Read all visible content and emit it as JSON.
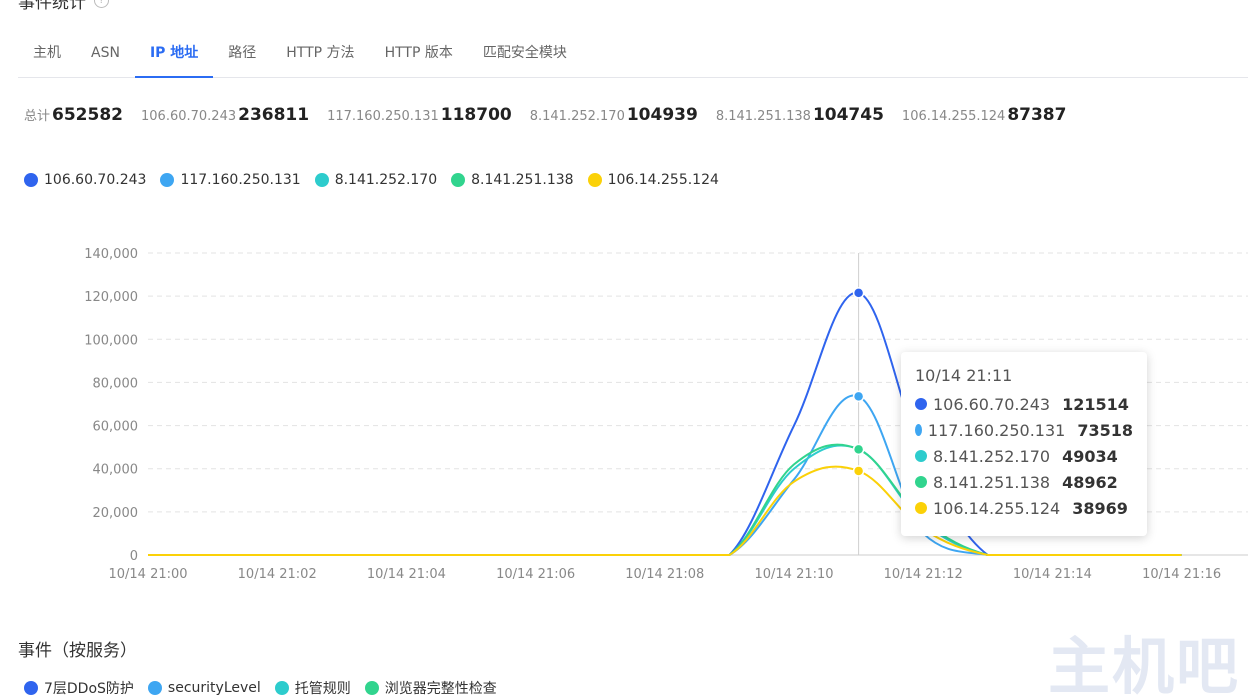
{
  "section": {
    "title": "事件统计",
    "help_icon": "question-circle-icon"
  },
  "tabs": [
    {
      "label": "主机",
      "active": false
    },
    {
      "label": "ASN",
      "active": false
    },
    {
      "label": "IP 地址",
      "active": true
    },
    {
      "label": "路径",
      "active": false
    },
    {
      "label": "HTTP 方法",
      "active": false
    },
    {
      "label": "HTTP 版本",
      "active": false
    },
    {
      "label": "匹配安全模块",
      "active": false
    }
  ],
  "stats": [
    {
      "label": "总计",
      "value": "652582"
    },
    {
      "label": "106.60.70.243",
      "value": "236811"
    },
    {
      "label": "117.160.250.131",
      "value": "118700"
    },
    {
      "label": "8.141.252.170",
      "value": "104939"
    },
    {
      "label": "8.141.251.138",
      "value": "104745"
    },
    {
      "label": "106.14.255.124",
      "value": "87387"
    }
  ],
  "colors": {
    "accent": "#2b6cf3",
    "series": [
      "#2f64ee",
      "#3ea6f2",
      "#2dcccd",
      "#31d48e",
      "#fbd108"
    ]
  },
  "chart_data": {
    "type": "line",
    "x": [
      "10/14 21:00",
      "10/14 21:01",
      "10/14 21:02",
      "10/14 21:03",
      "10/14 21:04",
      "10/14 21:05",
      "10/14 21:06",
      "10/14 21:07",
      "10/14 21:08",
      "10/14 21:09",
      "10/14 21:10",
      "10/14 21:11",
      "10/14 21:12",
      "10/14 21:13",
      "10/14 21:14",
      "10/14 21:15",
      "10/14 21:16"
    ],
    "xticks": [
      "10/14 21:00",
      "10/14 21:02",
      "10/14 21:04",
      "10/14 21:06",
      "10/14 21:08",
      "10/14 21:10",
      "10/14 21:12",
      "10/14 21:14",
      "10/14 21:16"
    ],
    "yticks": [
      "0",
      "20,000",
      "40,000",
      "60,000",
      "80,000",
      "100,000",
      "120,000",
      "140,000"
    ],
    "ylim": [
      0,
      140000
    ],
    "grid": true,
    "legend_position": "top-left",
    "series": [
      {
        "name": "106.60.70.243",
        "values": [
          0,
          0,
          0,
          0,
          0,
          0,
          0,
          0,
          0,
          0,
          60000,
          121514,
          45000,
          0,
          0,
          0,
          0
        ]
      },
      {
        "name": "117.160.250.131",
        "values": [
          0,
          0,
          0,
          0,
          0,
          0,
          0,
          0,
          0,
          0,
          35000,
          73518,
          10000,
          0,
          0,
          0,
          0
        ]
      },
      {
        "name": "8.141.252.170",
        "values": [
          0,
          0,
          0,
          0,
          0,
          0,
          0,
          0,
          0,
          0,
          40000,
          49034,
          15000,
          0,
          0,
          0,
          0
        ]
      },
      {
        "name": "8.141.251.138",
        "values": [
          0,
          0,
          0,
          0,
          0,
          0,
          0,
          0,
          0,
          0,
          42000,
          48962,
          16000,
          0,
          0,
          0,
          0
        ]
      },
      {
        "name": "106.14.255.124",
        "values": [
          0,
          0,
          0,
          0,
          0,
          0,
          0,
          0,
          0,
          0,
          34000,
          38969,
          12000,
          0,
          0,
          0,
          0
        ]
      }
    ],
    "hover_index": 11
  },
  "tooltip": {
    "time": "10/14 21:11",
    "rows": [
      {
        "name": "106.60.70.243",
        "value": "121514"
      },
      {
        "name": "117.160.250.131",
        "value": "73518"
      },
      {
        "name": "8.141.252.170",
        "value": "49034"
      },
      {
        "name": "8.141.251.138",
        "value": "48962"
      },
      {
        "name": "106.14.255.124",
        "value": "38969"
      }
    ]
  },
  "events": {
    "title": "事件（按服务）",
    "legend": [
      {
        "name": "7层DDoS防护",
        "color": "#2f64ee"
      },
      {
        "name": "securityLevel",
        "color": "#3ea6f2"
      },
      {
        "name": "托管规则",
        "color": "#2dcccd"
      },
      {
        "name": "浏览器完整性检查",
        "color": "#31d48e"
      }
    ]
  },
  "watermark": "主机吧"
}
